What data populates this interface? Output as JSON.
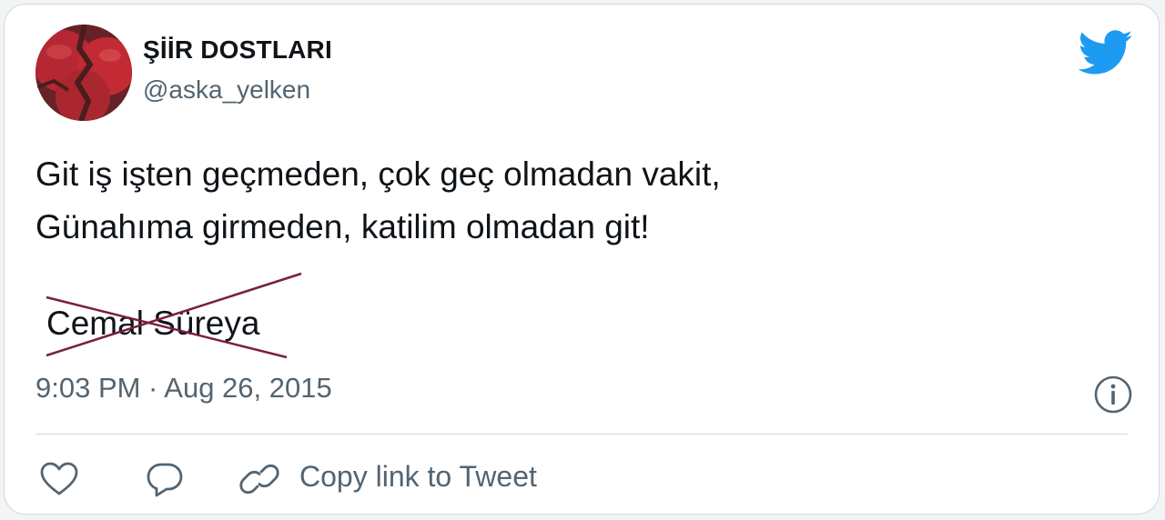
{
  "author": {
    "display_name": "ŞİİR DOSTLARI",
    "handle": "@aska_yelken"
  },
  "tweet": {
    "line1": "Git iş işten geçmeden, çok geç olmadan vakit,",
    "line2": "Günahıma girmeden, katilim olmadan git!",
    "attribution": "Cemal Süreya",
    "timestamp": "9:03 PM · Aug 26, 2015"
  },
  "actions": {
    "copy_link_label": "Copy link to Tweet"
  },
  "icons": {
    "brand": "twitter-bird-icon",
    "info": "info-icon",
    "like": "heart-icon",
    "reply": "reply-bubble-icon",
    "copy": "link-icon"
  },
  "colors": {
    "brand_blue": "#1d9bf0",
    "text_primary": "#0f1419",
    "text_secondary": "#536471",
    "crossout": "#7a1f3d",
    "border": "#cfd9de"
  }
}
